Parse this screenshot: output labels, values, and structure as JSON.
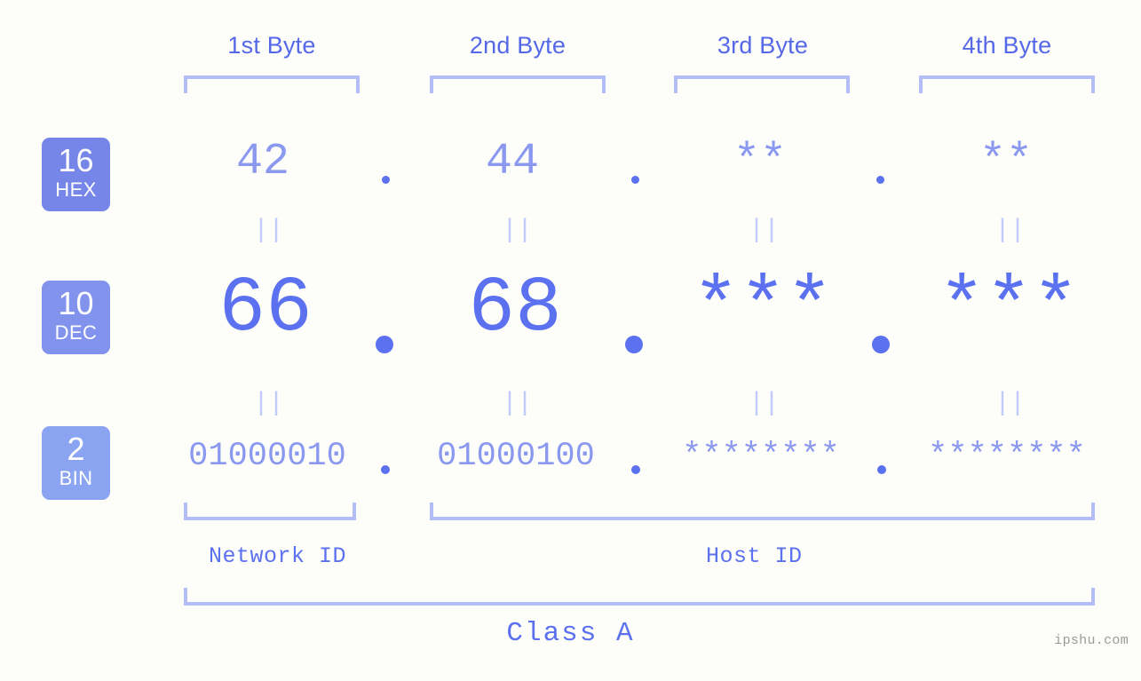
{
  "background_color": "#fdfefa",
  "accent_colors": {
    "primary": "#5b71ef",
    "light": "#8a99ef",
    "bracket": "#b3bdf7",
    "faint": "#c2cbf9",
    "badge_hex": "#7586e8",
    "badge_dec": "#8193ec",
    "badge_bin": "#8ba4f1",
    "watermark": "#9a9a9a"
  },
  "byte_headers": [
    {
      "label": "1st Byte"
    },
    {
      "label": "2nd Byte"
    },
    {
      "label": "3rd Byte"
    },
    {
      "label": "4th Byte"
    }
  ],
  "bases": [
    {
      "id": "hex",
      "number": "16",
      "name": "HEX"
    },
    {
      "id": "dec",
      "number": "10",
      "name": "DEC"
    },
    {
      "id": "bin",
      "number": "2",
      "name": "BIN"
    }
  ],
  "separator": ".",
  "equality_mark": "||",
  "rows": {
    "hex": {
      "base_number": "16",
      "base_name": "HEX",
      "values": [
        "42",
        "44",
        "**",
        "**"
      ]
    },
    "dec": {
      "base_number": "10",
      "base_name": "DEC",
      "values": [
        "66",
        "68",
        "***",
        "***"
      ]
    },
    "bin": {
      "base_number": "2",
      "base_name": "BIN",
      "values": [
        "01000010",
        "01000100",
        "********",
        "********"
      ]
    }
  },
  "segments": {
    "network_id": "Network ID",
    "host_id": "Host ID"
  },
  "class_label": "Class A",
  "watermark": "ipshu.com"
}
